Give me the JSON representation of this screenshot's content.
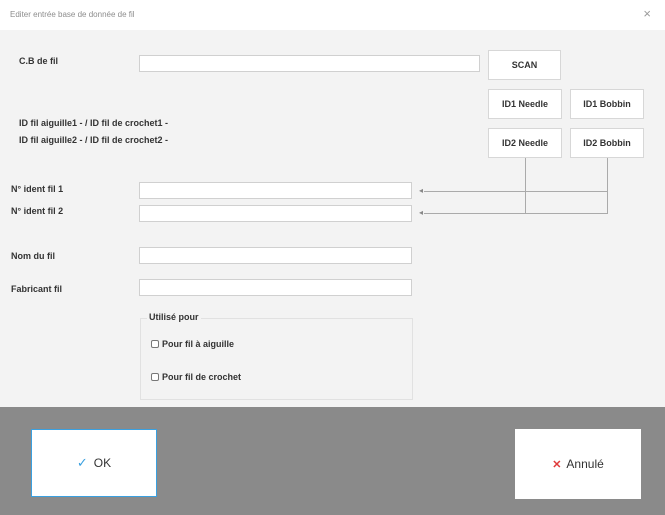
{
  "window": {
    "title": "Editer entrée base de donnée de fil",
    "close_glyph": "×"
  },
  "form": {
    "barcode_label": "C.B de fil",
    "barcode_value": "",
    "scan_label": "SCAN",
    "id_line1": "ID fil aiguille1 - / ID fil de crochet1 -",
    "id_line2": "ID fil aiguille2 - / ID fil de crochet2 -",
    "id1_needle": "ID1 Needle",
    "id1_bobbin": "ID1 Bobbin",
    "id2_needle": "ID2 Needle",
    "id2_bobbin": "ID2 Bobbin",
    "ident1_label": "N° ident fil 1",
    "ident1_value": "",
    "ident2_label": "N° ident fil 2",
    "ident2_value": "",
    "name_label": "Nom du fil",
    "name_value": "",
    "maker_label": "Fabricant fil",
    "maker_value": ""
  },
  "group": {
    "title": "Utilisé pour",
    "options": [
      {
        "label": "Pour fil à aiguille",
        "checked": false
      },
      {
        "label": "Pour fil de crochet",
        "checked": false
      }
    ]
  },
  "footer": {
    "ok_label": "OK",
    "ok_icon": "check-icon",
    "cancel_label": "Annulé",
    "cancel_icon": "x-icon",
    "ok_color": "#3aa0e0",
    "cancel_color": "#e03b3b"
  }
}
